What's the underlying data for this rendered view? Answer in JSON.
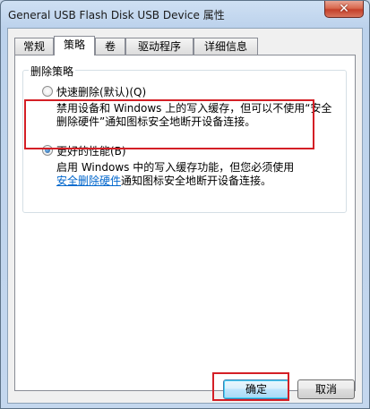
{
  "window": {
    "title": "General USB Flash Disk USB Device 属性",
    "close_glyph": "✕"
  },
  "tabs": [
    {
      "label": "常规",
      "active": false
    },
    {
      "label": "策略",
      "active": true
    },
    {
      "label": "卷",
      "active": false
    },
    {
      "label": "驱动程序",
      "active": false
    },
    {
      "label": "详细信息",
      "active": false
    }
  ],
  "group": {
    "legend": "删除策略",
    "options": [
      {
        "label": "快速删除(默认)(Q)",
        "selected": false,
        "desc_line1": "禁用设备和 Windows 上的写入缓存，但可以不使用“安全",
        "desc_line2": "删除硬件”通知图标安全地断开设备连接。"
      },
      {
        "label": "更好的性能(B)",
        "selected": true,
        "desc_line1": "启用 Windows 中的写入缓存功能，但您必须使用",
        "desc_link": "安全删除硬件",
        "desc_line2_rest": "通知图标安全地断开设备连接。"
      }
    ]
  },
  "buttons": {
    "ok": "确定",
    "cancel": "取消"
  },
  "colors": {
    "highlight_border": "#d41f26",
    "link": "#0066cc"
  }
}
